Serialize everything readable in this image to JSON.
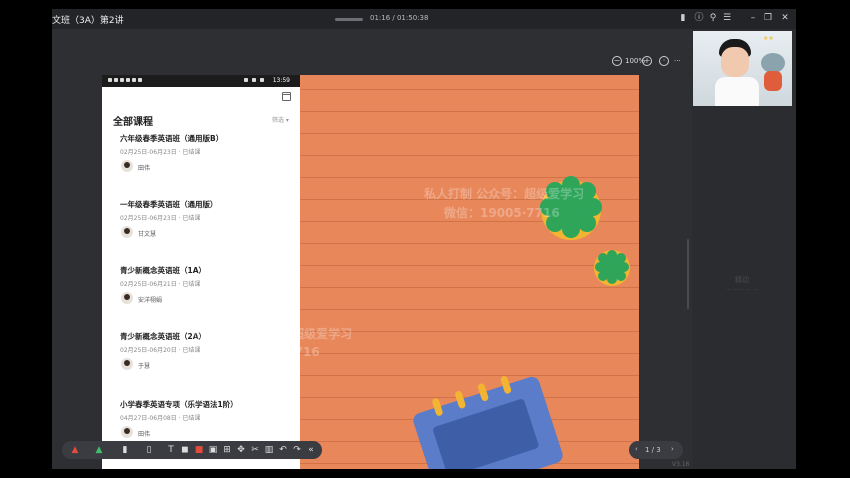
{
  "window": {
    "title": "文班（3A）第2讲",
    "time": "01:16 / 01:50:38",
    "controls": [
      "signal-icon",
      "info-icon",
      "search-icon",
      "menu-icon",
      "minimize-icon",
      "restore-icon",
      "close-icon"
    ]
  },
  "zoom": {
    "level": "100%"
  },
  "phone": {
    "status_time": "13:59",
    "heading": "全部课程",
    "filter_label": "筛选 ▾",
    "courses": [
      {
        "name": "六年级春季英语班（通用版B）",
        "date": "02月25日-06月23日 · 已结课",
        "teacher": "田伟"
      },
      {
        "name": "一年级春季英语班（通用版）",
        "date": "02月25日-06月23日 · 已结课",
        "teacher": "甘文慧"
      },
      {
        "name": "青少新概念英语班（1A）",
        "date": "02月25日-06月21日 · 已结课",
        "teacher": "安洋栩娟"
      },
      {
        "name": "青少新概念英语班（2A）",
        "date": "02月25日-06月20日 · 已结课",
        "teacher": "于慧"
      },
      {
        "name": "小学春季英语专项（乐学语法1阶）",
        "date": "04月27日-06月08日 · 已结课",
        "teacher": "田伟"
      }
    ]
  },
  "watermark": {
    "line1": "私人打制 公众号：超级爱学习",
    "line2": "微信：19005⋅7716"
  },
  "pager": {
    "label": "1 / 3"
  },
  "side": {
    "logo": "精动",
    "version": "V3.16"
  },
  "colors": {
    "slide": "#e8875a",
    "accent_green": "#2fa55a",
    "notebook": "#5a7cc9"
  }
}
